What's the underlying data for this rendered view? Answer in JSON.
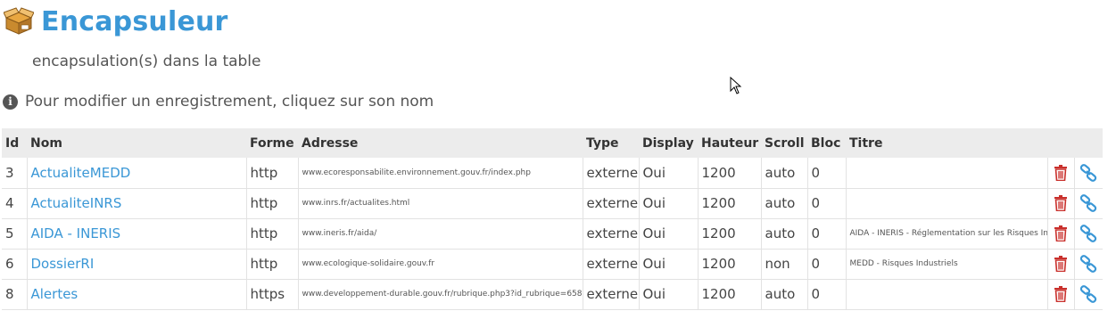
{
  "header": {
    "title": "Encapsuleur",
    "count_text": "encapsulation(s) dans la table",
    "info_text": "Pour modifier un enregistrement, cliquez sur son nom",
    "icon": "open-box-icon"
  },
  "table": {
    "columns": {
      "id": "Id",
      "nom": "Nom",
      "forme": "Forme",
      "adresse": "Adresse",
      "type": "Type",
      "display": "Display",
      "hauteur": "Hauteur",
      "scroll": "Scroll",
      "bloc": "Bloc",
      "titre": "Titre"
    },
    "rows": [
      {
        "id": "3",
        "nom": "ActualiteMEDD",
        "forme": "http",
        "adresse": "www.ecoresponsabilite.environnement.gouv.fr/index.php",
        "type": "externe",
        "display": "Oui",
        "hauteur": "1200",
        "scroll": "auto",
        "bloc": "0",
        "titre": ""
      },
      {
        "id": "4",
        "nom": "ActualiteINRS",
        "forme": "http",
        "adresse": "www.inrs.fr/actualites.html",
        "type": "externe",
        "display": "Oui",
        "hauteur": "1200",
        "scroll": "auto",
        "bloc": "0",
        "titre": ""
      },
      {
        "id": "5",
        "nom": "AIDA - INERIS",
        "forme": "http",
        "adresse": "www.ineris.fr/aida/",
        "type": "externe",
        "display": "Oui",
        "hauteur": "1200",
        "scroll": "auto",
        "bloc": "0",
        "titre": "AIDA - INERIS - Réglementation sur les Risques In"
      },
      {
        "id": "6",
        "nom": "DossierRI",
        "forme": "http",
        "adresse": "www.ecologique-solidaire.gouv.fr",
        "type": "externe",
        "display": "Oui",
        "hauteur": "1200",
        "scroll": "non",
        "bloc": "0",
        "titre": "MEDD - Risques Industriels"
      },
      {
        "id": "8",
        "nom": "Alertes",
        "forme": "https",
        "adresse": "www.developpement-durable.gouv.fr/rubrique.php3?id_rubrique=658",
        "type": "externe",
        "display": "Oui",
        "hauteur": "1200",
        "scroll": "auto",
        "bloc": "0",
        "titre": ""
      }
    ]
  },
  "icons": {
    "delete": "trash-icon",
    "link": "chain-link-icon"
  },
  "colors": {
    "accent": "#3a97d6",
    "delete": "#c9302c",
    "header_bg": "#ececec"
  }
}
